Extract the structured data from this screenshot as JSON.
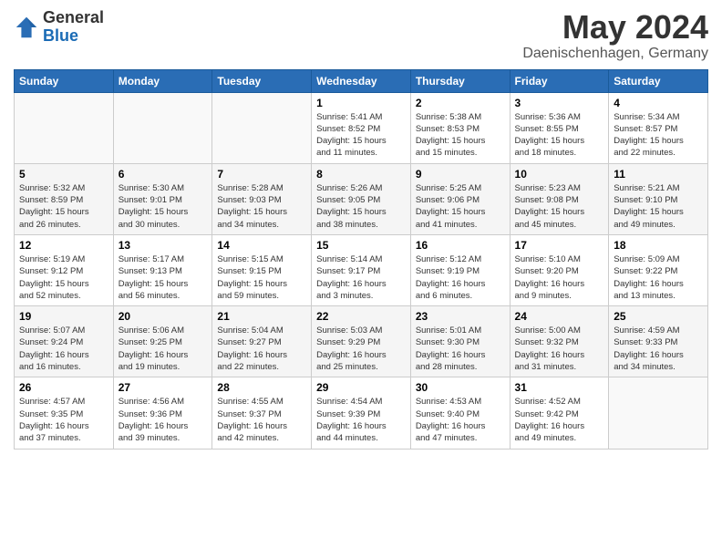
{
  "header": {
    "logo_line1": "General",
    "logo_line2": "Blue",
    "month_year": "May 2024",
    "location": "Daenischenhagen, Germany"
  },
  "weekdays": [
    "Sunday",
    "Monday",
    "Tuesday",
    "Wednesday",
    "Thursday",
    "Friday",
    "Saturday"
  ],
  "weeks": [
    [
      {
        "day": "",
        "info": ""
      },
      {
        "day": "",
        "info": ""
      },
      {
        "day": "",
        "info": ""
      },
      {
        "day": "1",
        "info": "Sunrise: 5:41 AM\nSunset: 8:52 PM\nDaylight: 15 hours\nand 11 minutes."
      },
      {
        "day": "2",
        "info": "Sunrise: 5:38 AM\nSunset: 8:53 PM\nDaylight: 15 hours\nand 15 minutes."
      },
      {
        "day": "3",
        "info": "Sunrise: 5:36 AM\nSunset: 8:55 PM\nDaylight: 15 hours\nand 18 minutes."
      },
      {
        "day": "4",
        "info": "Sunrise: 5:34 AM\nSunset: 8:57 PM\nDaylight: 15 hours\nand 22 minutes."
      }
    ],
    [
      {
        "day": "5",
        "info": "Sunrise: 5:32 AM\nSunset: 8:59 PM\nDaylight: 15 hours\nand 26 minutes."
      },
      {
        "day": "6",
        "info": "Sunrise: 5:30 AM\nSunset: 9:01 PM\nDaylight: 15 hours\nand 30 minutes."
      },
      {
        "day": "7",
        "info": "Sunrise: 5:28 AM\nSunset: 9:03 PM\nDaylight: 15 hours\nand 34 minutes."
      },
      {
        "day": "8",
        "info": "Sunrise: 5:26 AM\nSunset: 9:05 PM\nDaylight: 15 hours\nand 38 minutes."
      },
      {
        "day": "9",
        "info": "Sunrise: 5:25 AM\nSunset: 9:06 PM\nDaylight: 15 hours\nand 41 minutes."
      },
      {
        "day": "10",
        "info": "Sunrise: 5:23 AM\nSunset: 9:08 PM\nDaylight: 15 hours\nand 45 minutes."
      },
      {
        "day": "11",
        "info": "Sunrise: 5:21 AM\nSunset: 9:10 PM\nDaylight: 15 hours\nand 49 minutes."
      }
    ],
    [
      {
        "day": "12",
        "info": "Sunrise: 5:19 AM\nSunset: 9:12 PM\nDaylight: 15 hours\nand 52 minutes."
      },
      {
        "day": "13",
        "info": "Sunrise: 5:17 AM\nSunset: 9:13 PM\nDaylight: 15 hours\nand 56 minutes."
      },
      {
        "day": "14",
        "info": "Sunrise: 5:15 AM\nSunset: 9:15 PM\nDaylight: 15 hours\nand 59 minutes."
      },
      {
        "day": "15",
        "info": "Sunrise: 5:14 AM\nSunset: 9:17 PM\nDaylight: 16 hours\nand 3 minutes."
      },
      {
        "day": "16",
        "info": "Sunrise: 5:12 AM\nSunset: 9:19 PM\nDaylight: 16 hours\nand 6 minutes."
      },
      {
        "day": "17",
        "info": "Sunrise: 5:10 AM\nSunset: 9:20 PM\nDaylight: 16 hours\nand 9 minutes."
      },
      {
        "day": "18",
        "info": "Sunrise: 5:09 AM\nSunset: 9:22 PM\nDaylight: 16 hours\nand 13 minutes."
      }
    ],
    [
      {
        "day": "19",
        "info": "Sunrise: 5:07 AM\nSunset: 9:24 PM\nDaylight: 16 hours\nand 16 minutes."
      },
      {
        "day": "20",
        "info": "Sunrise: 5:06 AM\nSunset: 9:25 PM\nDaylight: 16 hours\nand 19 minutes."
      },
      {
        "day": "21",
        "info": "Sunrise: 5:04 AM\nSunset: 9:27 PM\nDaylight: 16 hours\nand 22 minutes."
      },
      {
        "day": "22",
        "info": "Sunrise: 5:03 AM\nSunset: 9:29 PM\nDaylight: 16 hours\nand 25 minutes."
      },
      {
        "day": "23",
        "info": "Sunrise: 5:01 AM\nSunset: 9:30 PM\nDaylight: 16 hours\nand 28 minutes."
      },
      {
        "day": "24",
        "info": "Sunrise: 5:00 AM\nSunset: 9:32 PM\nDaylight: 16 hours\nand 31 minutes."
      },
      {
        "day": "25",
        "info": "Sunrise: 4:59 AM\nSunset: 9:33 PM\nDaylight: 16 hours\nand 34 minutes."
      }
    ],
    [
      {
        "day": "26",
        "info": "Sunrise: 4:57 AM\nSunset: 9:35 PM\nDaylight: 16 hours\nand 37 minutes."
      },
      {
        "day": "27",
        "info": "Sunrise: 4:56 AM\nSunset: 9:36 PM\nDaylight: 16 hours\nand 39 minutes."
      },
      {
        "day": "28",
        "info": "Sunrise: 4:55 AM\nSunset: 9:37 PM\nDaylight: 16 hours\nand 42 minutes."
      },
      {
        "day": "29",
        "info": "Sunrise: 4:54 AM\nSunset: 9:39 PM\nDaylight: 16 hours\nand 44 minutes."
      },
      {
        "day": "30",
        "info": "Sunrise: 4:53 AM\nSunset: 9:40 PM\nDaylight: 16 hours\nand 47 minutes."
      },
      {
        "day": "31",
        "info": "Sunrise: 4:52 AM\nSunset: 9:42 PM\nDaylight: 16 hours\nand 49 minutes."
      },
      {
        "day": "",
        "info": ""
      }
    ]
  ]
}
